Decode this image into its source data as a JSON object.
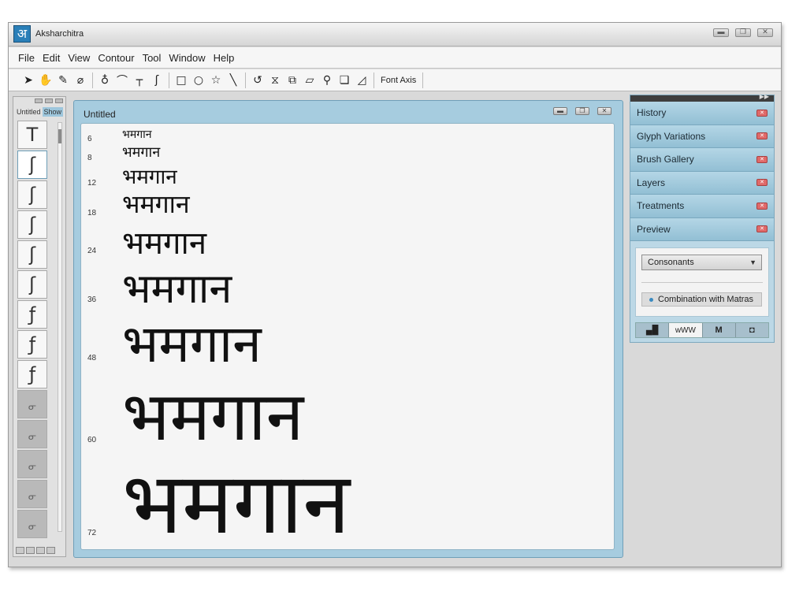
{
  "app": {
    "title": "Aksharchitra",
    "logo_glyph": "अ",
    "accent": "#2a7fb8"
  },
  "menu": [
    "File",
    "Edit",
    "View",
    "Contour",
    "Tool",
    "Window",
    "Help"
  ],
  "toolbar": {
    "tools": [
      "pointer-tool",
      "hand-tool",
      "pen-tool",
      "ruler-tool",
      "nib-tool",
      "curve-tool",
      "corner-tool",
      "hook-tool",
      "rectangle-tool",
      "ellipse-tool",
      "star-tool",
      "line-tool",
      "rotate-tool",
      "reflect-tool",
      "scale-tool",
      "skew-tool",
      "zoom-tool",
      "copy-tool",
      "shape-tool"
    ],
    "font_axis_label": "Font Axis"
  },
  "left_panel": {
    "tabs": [
      "Untitled",
      "Show"
    ],
    "glyphs": [
      "T",
      "ʃ",
      "ʃ",
      "ʃ",
      "ʃ",
      "ʃ",
      "ƒ",
      "ƒ",
      "ƒ",
      "",
      "",
      "",
      "",
      ""
    ]
  },
  "document": {
    "title": "Untitled",
    "sample_text": "भमगान",
    "sizes": [
      "6",
      "8",
      "12",
      "18",
      "24",
      "36",
      "48",
      "60",
      "72"
    ]
  },
  "right_panel": {
    "sections": [
      "History",
      "Glyph Variations",
      "Brush Gallery",
      "Layers",
      "Treatments",
      "Preview"
    ],
    "preview": {
      "dropdown_value": "Consonants",
      "combination_label": "Combination with Matras",
      "tabs": [
        "",
        "wWW",
        "M",
        ""
      ]
    }
  }
}
